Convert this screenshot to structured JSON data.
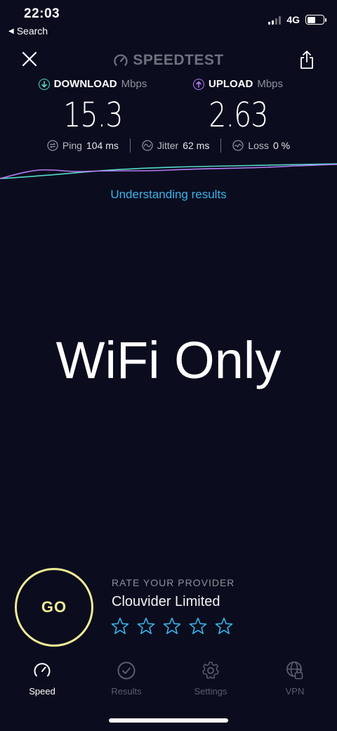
{
  "status_bar": {
    "time": "22:03",
    "back_label": "Search",
    "network": "4G",
    "signal_bars_active": 2,
    "battery_level": 0.52
  },
  "header": {
    "brand": "SPEEDTEST",
    "close_icon": "close-icon",
    "share_icon": "share-icon"
  },
  "download": {
    "label": "DOWNLOAD",
    "unit": "Mbps",
    "value": "15.3",
    "color": "#56d9c9"
  },
  "upload": {
    "label": "UPLOAD",
    "unit": "Mbps",
    "value": "2.63",
    "color": "#b57cf6"
  },
  "stats": {
    "ping": {
      "label": "Ping",
      "value": "104",
      "unit": "ms"
    },
    "jitter": {
      "label": "Jitter",
      "value": "62",
      "unit": "ms"
    },
    "loss": {
      "label": "Loss",
      "value": "0",
      "unit": "%"
    }
  },
  "understanding_link": "Understanding results",
  "overlay_text": "WiFi Only",
  "go_button": "GO",
  "rating": {
    "title": "RATE YOUR PROVIDER",
    "provider": "Clouvider Limited",
    "stars_total": 5,
    "stars_selected": 0,
    "star_color": "#3ab2e6"
  },
  "tabs": [
    {
      "label": "Speed",
      "icon": "speed-gauge-icon",
      "active": true
    },
    {
      "label": "Results",
      "icon": "results-check-icon",
      "active": false
    },
    {
      "label": "Settings",
      "icon": "settings-gear-icon",
      "active": false
    },
    {
      "label": "VPN",
      "icon": "vpn-globe-lock-icon",
      "active": false
    }
  ],
  "colors": {
    "background": "#0b0d1e",
    "accent_link": "#3ab2e6",
    "go_ring": "#f0ec95"
  }
}
